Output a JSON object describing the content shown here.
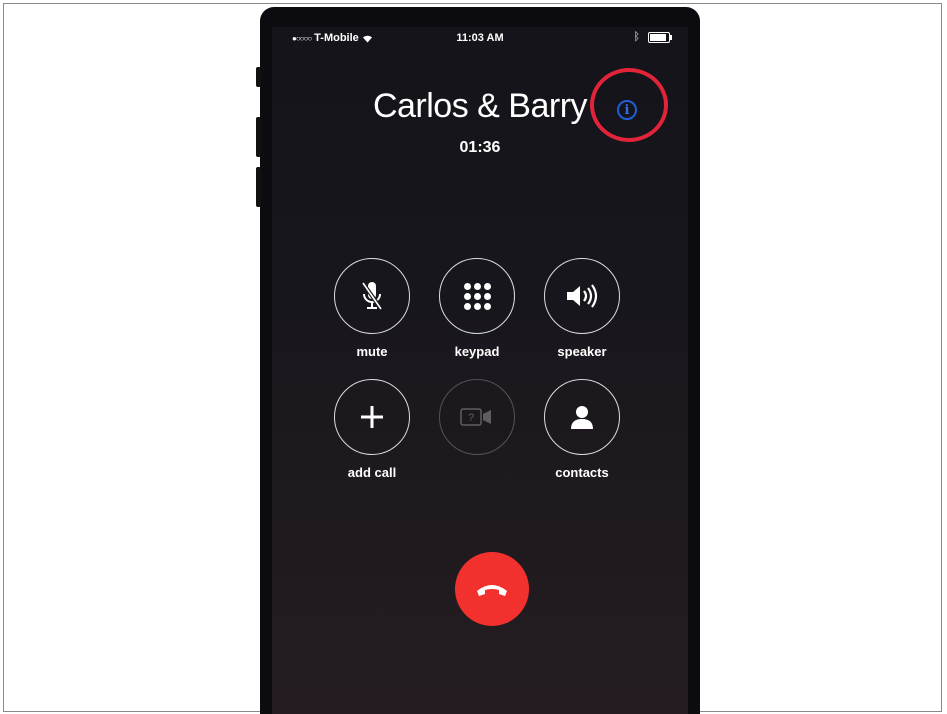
{
  "status_bar": {
    "signal": "●○○○○",
    "carrier": "T-Mobile",
    "time": "11:03 AM"
  },
  "call": {
    "caller": "Carlos & Barry",
    "duration": "01:36",
    "info_icon": "i"
  },
  "controls": [
    {
      "label": "mute",
      "icon": "microphone-muted-icon"
    },
    {
      "label": "keypad",
      "icon": "keypad-icon"
    },
    {
      "label": "speaker",
      "icon": "speaker-icon"
    },
    {
      "label": "add call",
      "icon": "plus-icon"
    },
    {
      "label": "",
      "icon": "facetime-icon"
    },
    {
      "label": "contacts",
      "icon": "contact-icon"
    }
  ],
  "colors": {
    "end_call": "#f2312e",
    "info_accent": "#2f6ee8",
    "highlight": "#e2243a"
  }
}
